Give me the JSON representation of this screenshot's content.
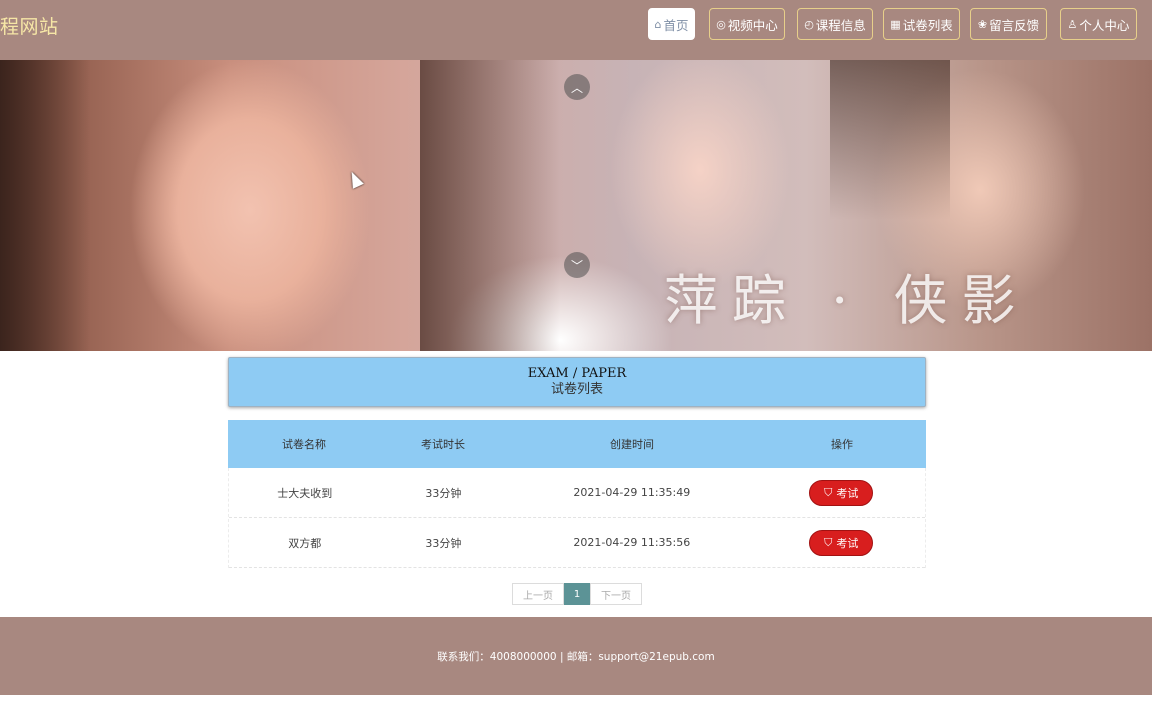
{
  "header": {
    "site_title": "程网站",
    "nav": [
      {
        "icon": "home-icon",
        "glyph": "⌂",
        "label": "首页",
        "active": true
      },
      {
        "icon": "video-icon",
        "glyph": "◎",
        "label": "视频中心",
        "active": false
      },
      {
        "icon": "power-icon",
        "glyph": "◴",
        "label": "课程信息",
        "active": false
      },
      {
        "icon": "grid-icon",
        "glyph": "▦",
        "label": "试卷列表",
        "active": false
      },
      {
        "icon": "flower-icon",
        "glyph": "❀",
        "label": "留言反馈",
        "active": false
      },
      {
        "icon": "user-icon",
        "glyph": "♙",
        "label": "个人中心",
        "active": false
      }
    ]
  },
  "banner": {
    "caption": "萍踪 · 侠影",
    "arrow_up": "︿",
    "arrow_down": "﹀"
  },
  "section": {
    "title_en": "EXAM / PAPER",
    "title_zh": "试卷列表"
  },
  "table": {
    "headers": [
      "试卷名称",
      "考试时长",
      "创建时间",
      "操作"
    ],
    "rows": [
      {
        "name": "士大夫收到",
        "duration": "33分钟",
        "created": "2021-04-29 11:35:49",
        "action": "考试"
      },
      {
        "name": "双方都",
        "duration": "33分钟",
        "created": "2021-04-29 11:35:56",
        "action": "考试"
      }
    ]
  },
  "pager": {
    "prev": "上一页",
    "current": "1",
    "next": "下一页"
  },
  "footer": {
    "text": "联系我们：4008000000 | 邮箱：support@21epub.com"
  },
  "colors": {
    "header_bg": "#a88880",
    "title_color": "#f6e6a6",
    "table_header_bg": "#8ecbf3",
    "exam_button": "#d81e1e",
    "pager_active": "#5c9396"
  }
}
